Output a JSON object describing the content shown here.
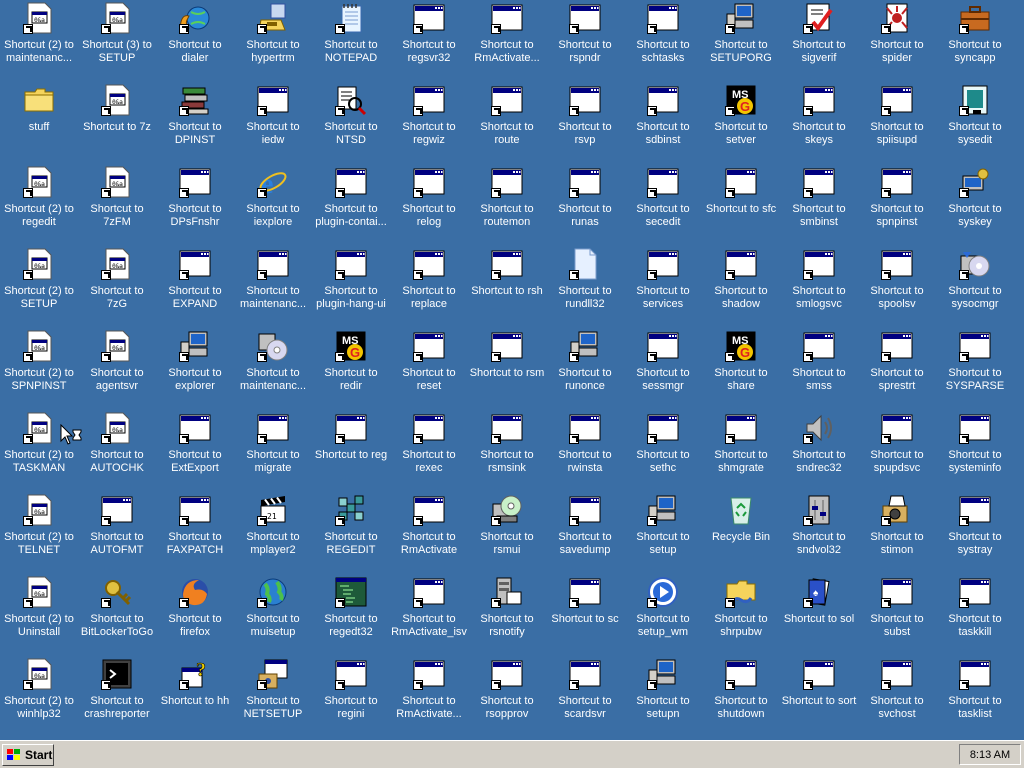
{
  "desktop": {
    "icons": [
      {
        "label": "Shortcut (2) to maintenanc...",
        "icon": "doc-icon"
      },
      {
        "label": "stuff",
        "icon": "folder-icon"
      },
      {
        "label": "Shortcut (2) to regedit",
        "icon": "doc-icon"
      },
      {
        "label": "Shortcut (2) to SETUP",
        "icon": "doc-icon"
      },
      {
        "label": "Shortcut (2) to SPNPINST",
        "icon": "doc-icon"
      },
      {
        "label": "Shortcut (2) to TASKMAN",
        "icon": "doc-icon"
      },
      {
        "label": "Shortcut (2) to TELNET",
        "icon": "doc-icon"
      },
      {
        "label": "Shortcut (2) to Uninstall",
        "icon": "doc-icon"
      },
      {
        "label": "Shortcut (2) to winhlp32",
        "icon": "doc-icon"
      },
      {
        "label": "Shortcut (3) to SETUP",
        "icon": "doc-icon"
      },
      {
        "label": "Shortcut to 7z",
        "icon": "doc-icon"
      },
      {
        "label": "Shortcut to 7zFM",
        "icon": "doc-icon"
      },
      {
        "label": "Shortcut to 7zG",
        "icon": "doc-icon"
      },
      {
        "label": "Shortcut to agentsvr",
        "icon": "doc-icon"
      },
      {
        "label": "Shortcut to AUTOCHK",
        "icon": "doc-icon"
      },
      {
        "label": "Shortcut to AUTOFMT",
        "icon": "window-icon"
      },
      {
        "label": "Shortcut to BitLockerToGo",
        "icon": "key-icon"
      },
      {
        "label": "Shortcut to crashreporter",
        "icon": "terminal-icon"
      },
      {
        "label": "Shortcut to dialer",
        "icon": "phone-globe-icon"
      },
      {
        "label": "Shortcut to DPINST",
        "icon": "books-icon"
      },
      {
        "label": "Shortcut to DPsFnshr",
        "icon": "window-icon"
      },
      {
        "label": "Shortcut to EXPAND",
        "icon": "window-icon"
      },
      {
        "label": "Shortcut to explorer",
        "icon": "computer-icon"
      },
      {
        "label": "Shortcut to ExtExport",
        "icon": "window-icon"
      },
      {
        "label": "Shortcut to FAXPATCH",
        "icon": "window-icon"
      },
      {
        "label": "Shortcut to firefox",
        "icon": "firefox-icon"
      },
      {
        "label": "Shortcut to hh",
        "icon": "help-icon"
      },
      {
        "label": "Shortcut to hypertrm",
        "icon": "phone-icon"
      },
      {
        "label": "Shortcut to iedw",
        "icon": "window-icon"
      },
      {
        "label": "Shortcut to iexplore",
        "icon": "ie-icon"
      },
      {
        "label": "Shortcut to maintenanc...",
        "icon": "window-icon"
      },
      {
        "label": "Shortcut to maintenanc...",
        "icon": "cd-icon"
      },
      {
        "label": "Shortcut to migrate",
        "icon": "window-icon"
      },
      {
        "label": "Shortcut to mplayer2",
        "icon": "clapper-icon"
      },
      {
        "label": "Shortcut to muisetup",
        "icon": "globe-icon"
      },
      {
        "label": "Shortcut to NETSETUP",
        "icon": "setup-icon"
      },
      {
        "label": "Shortcut to NOTEPAD",
        "icon": "notepad-icon"
      },
      {
        "label": "Shortcut to NTSD",
        "icon": "debug-icon"
      },
      {
        "label": "Shortcut to plugin-contai...",
        "icon": "window-icon"
      },
      {
        "label": "Shortcut to plugin-hang-ui",
        "icon": "window-icon"
      },
      {
        "label": "Shortcut to redir",
        "icon": "ms-icon"
      },
      {
        "label": "Shortcut to reg",
        "icon": "window-icon"
      },
      {
        "label": "Shortcut to REGEDIT",
        "icon": "regedit-icon"
      },
      {
        "label": "Shortcut to regedt32",
        "icon": "regedt32-icon"
      },
      {
        "label": "Shortcut to regini",
        "icon": "window-icon"
      },
      {
        "label": "Shortcut to regsvr32",
        "icon": "window-icon"
      },
      {
        "label": "Shortcut to regwiz",
        "icon": "window-icon"
      },
      {
        "label": "Shortcut to relog",
        "icon": "window-icon"
      },
      {
        "label": "Shortcut to replace",
        "icon": "window-icon"
      },
      {
        "label": "Shortcut to reset",
        "icon": "window-icon"
      },
      {
        "label": "Shortcut to rexec",
        "icon": "window-icon"
      },
      {
        "label": "Shortcut to RmActivate",
        "icon": "window-icon"
      },
      {
        "label": "Shortcut to RmActivate_isv",
        "icon": "window-icon"
      },
      {
        "label": "Shortcut to RmActivate...",
        "icon": "window-icon"
      },
      {
        "label": "Shortcut to RmActivate...",
        "icon": "window-icon"
      },
      {
        "label": "Shortcut to route",
        "icon": "window-icon"
      },
      {
        "label": "Shortcut to routemon",
        "icon": "window-icon"
      },
      {
        "label": "Shortcut to rsh",
        "icon": "window-icon"
      },
      {
        "label": "Shortcut to rsm",
        "icon": "window-icon"
      },
      {
        "label": "Shortcut to rsmsink",
        "icon": "window-icon"
      },
      {
        "label": "Shortcut to rsmui",
        "icon": "rsmui-icon"
      },
      {
        "label": "Shortcut to rsnotify",
        "icon": "rsnotify-icon"
      },
      {
        "label": "Shortcut to rsopprov",
        "icon": "window-icon"
      },
      {
        "label": "Shortcut to rspndr",
        "icon": "window-icon"
      },
      {
        "label": "Shortcut to rsvp",
        "icon": "window-icon"
      },
      {
        "label": "Shortcut to runas",
        "icon": "window-icon"
      },
      {
        "label": "Shortcut to rundll32",
        "icon": "blank-doc-icon"
      },
      {
        "label": "Shortcut to runonce",
        "icon": "computer-icon"
      },
      {
        "label": "Shortcut to rwinsta",
        "icon": "window-icon"
      },
      {
        "label": "Shortcut to savedump",
        "icon": "window-icon"
      },
      {
        "label": "Shortcut to sc",
        "icon": "window-icon"
      },
      {
        "label": "Shortcut to scardsvr",
        "icon": "window-icon"
      },
      {
        "label": "Shortcut to schtasks",
        "icon": "window-icon"
      },
      {
        "label": "Shortcut to sdbinst",
        "icon": "window-icon"
      },
      {
        "label": "Shortcut to secedit",
        "icon": "window-icon"
      },
      {
        "label": "Shortcut to services",
        "icon": "window-icon"
      },
      {
        "label": "Shortcut to sessmgr",
        "icon": "window-icon"
      },
      {
        "label": "Shortcut to sethc",
        "icon": "window-icon"
      },
      {
        "label": "Shortcut to setup",
        "icon": "computer-icon"
      },
      {
        "label": "Shortcut to setup_wm",
        "icon": "media-icon"
      },
      {
        "label": "Shortcut to setupn",
        "icon": "computer-icon"
      },
      {
        "label": "Shortcut to SETUPORG",
        "icon": "computer-icon"
      },
      {
        "label": "Shortcut to setver",
        "icon": "ms-icon"
      },
      {
        "label": "Shortcut to sfc",
        "icon": "window-icon"
      },
      {
        "label": "Shortcut to shadow",
        "icon": "window-icon"
      },
      {
        "label": "Shortcut to share",
        "icon": "ms-icon"
      },
      {
        "label": "Shortcut to shmgrate",
        "icon": "window-icon"
      },
      {
        "label": "Recycle Bin",
        "icon": "recycle-bin-icon"
      },
      {
        "label": "Shortcut to shrpubw",
        "icon": "share-folder-icon"
      },
      {
        "label": "Shortcut to shutdown",
        "icon": "window-icon"
      },
      {
        "label": "Shortcut to sigverif",
        "icon": "sigverif-icon"
      },
      {
        "label": "Shortcut to skeys",
        "icon": "window-icon"
      },
      {
        "label": "Shortcut to smbinst",
        "icon": "window-icon"
      },
      {
        "label": "Shortcut to smlogsvc",
        "icon": "window-icon"
      },
      {
        "label": "Shortcut to smss",
        "icon": "window-icon"
      },
      {
        "label": "Shortcut to sndrec32",
        "icon": "speaker-icon"
      },
      {
        "label": "Shortcut to sndvol32",
        "icon": "sndvol-icon"
      },
      {
        "label": "Shortcut to sol",
        "icon": "sol-icon"
      },
      {
        "label": "Shortcut to sort",
        "icon": "window-icon"
      },
      {
        "label": "Shortcut to spider",
        "icon": "spider-icon"
      },
      {
        "label": "Shortcut to spiisupd",
        "icon": "window-icon"
      },
      {
        "label": "Shortcut to spnpinst",
        "icon": "window-icon"
      },
      {
        "label": "Shortcut to spoolsv",
        "icon": "window-icon"
      },
      {
        "label": "Shortcut to sprestrt",
        "icon": "window-icon"
      },
      {
        "label": "Shortcut to spupdsvc",
        "icon": "window-icon"
      },
      {
        "label": "Shortcut to stimon",
        "icon": "camera-icon"
      },
      {
        "label": "Shortcut to subst",
        "icon": "window-icon"
      },
      {
        "label": "Shortcut to svchost",
        "icon": "window-icon"
      },
      {
        "label": "Shortcut to syncapp",
        "icon": "briefcase-icon"
      },
      {
        "label": "Shortcut to sysedit",
        "icon": "sysedit-icon"
      },
      {
        "label": "Shortcut to syskey",
        "icon": "syskey-icon"
      },
      {
        "label": "Shortcut to sysocmgr",
        "icon": "sysocmgr-icon"
      },
      {
        "label": "Shortcut to SYSPARSE",
        "icon": "window-icon"
      },
      {
        "label": "Shortcut to systeminfo",
        "icon": "window-icon"
      },
      {
        "label": "Shortcut to systray",
        "icon": "window-icon"
      },
      {
        "label": "Shortcut to taskkill",
        "icon": "window-icon"
      },
      {
        "label": "Shortcut to tasklist",
        "icon": "window-icon"
      }
    ]
  },
  "taskbar": {
    "start_label": "Start",
    "clock": "8:13 AM"
  },
  "colors": {
    "desktop": "#3a6ea5",
    "taskbar": "#d4d0c8",
    "title_blue": "#000080"
  }
}
